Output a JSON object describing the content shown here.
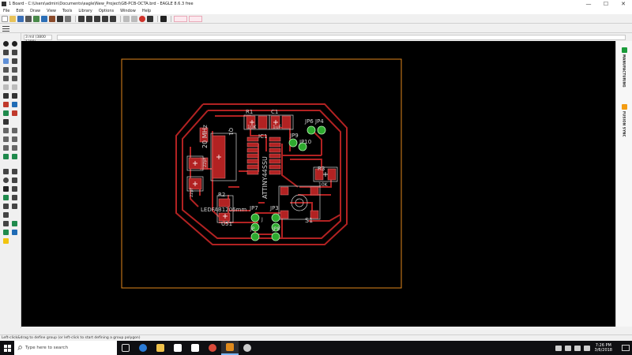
{
  "window": {
    "title": "1 Board - C:\\Users\\admin\\Documents\\eagle\\New_Project\\GB-PCB-OCTA.brd - EAGLE 8.6.3 free",
    "minimize": "—",
    "maximize": "☐",
    "close": "✕"
  },
  "menu": [
    "File",
    "Edit",
    "Draw",
    "View",
    "Tools",
    "Library",
    "Options",
    "Window",
    "Help"
  ],
  "coordinates": "3 mil (3800 1390)",
  "right_panel": {
    "tabs": [
      {
        "label": "MANUFACTURING",
        "badge_color": "#1a9c3a"
      },
      {
        "label": "FUSION SYNC",
        "badge_color": "#f39c12"
      }
    ]
  },
  "status": {
    "message": "Left-click&drag to define group (or left-click to start defining a group polygon)"
  },
  "taskbar": {
    "search_placeholder": "Type here to search",
    "time": "7:26 PM",
    "date": "3/6/2018"
  },
  "board": {
    "outline_color": "#e0861c",
    "trace_color": "#b22222",
    "pad_color": "#b22222",
    "via_color": "#2eaa2e",
    "silk_color": "#d3d3d3",
    "labels": {
      "r1": "R1",
      "r1_value": "10K",
      "c1": "C1",
      "c1_value": "1uF",
      "crystal": "20 MHz",
      "q1": "Q1",
      "cap_22pf_1": "22pF",
      "cap_22pf_2": "22pF",
      "ic": "IC1",
      "ic_name": "ATTINY44SSU",
      "jp6": "JP6",
      "jp4": "JP4",
      "jp9": "JP9",
      "jp10": "JP10",
      "r3": "R3",
      "r3_value": "10K",
      "r2": "R2",
      "led": "LEDFAB1206mm",
      "u51": "U51",
      "jp7": "JP7",
      "jp3": "JP3",
      "s1": "S1",
      "jp_a": "J",
      "jp_b": "JP8",
      "jp_c": "JP"
    }
  }
}
